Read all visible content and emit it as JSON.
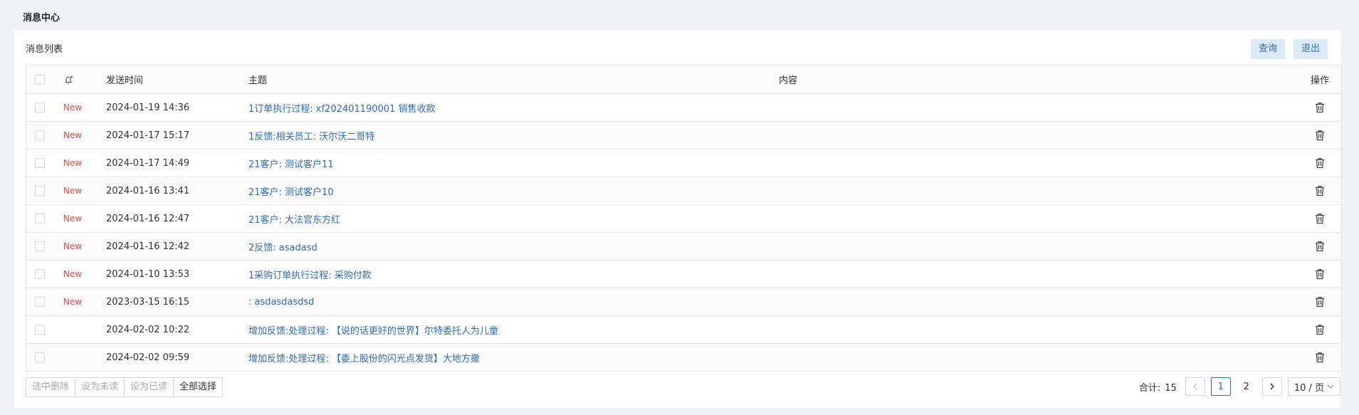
{
  "header": {
    "title": "消息中心"
  },
  "panel": {
    "title": "消息列表",
    "query_label": "查询",
    "exit_label": "退出"
  },
  "table": {
    "columns": {
      "time": "发送时间",
      "subject": "主题",
      "content": "内容",
      "operation": "操作"
    },
    "rows": [
      {
        "status": "New",
        "time": "2024-01-19 14:36",
        "subject": "1订单执行过程: xf202401190001 销售收款",
        "content": ""
      },
      {
        "status": "New",
        "time": "2024-01-17 15:17",
        "subject": "1反馈:相关员工: 沃尔沃二哥特",
        "content": ""
      },
      {
        "status": "New",
        "time": "2024-01-17 14:49",
        "subject": "21客户: 测试客户11",
        "content": ""
      },
      {
        "status": "New",
        "time": "2024-01-16 13:41",
        "subject": "21客户: 测试客户10",
        "content": ""
      },
      {
        "status": "New",
        "time": "2024-01-16 12:47",
        "subject": "21客户: 大法官东方红",
        "content": ""
      },
      {
        "status": "New",
        "time": "2024-01-16 12:42",
        "subject": "2反馈: asadasd",
        "content": ""
      },
      {
        "status": "New",
        "time": "2024-01-10 13:53",
        "subject": "1采购订单执行过程: 采购付款",
        "content": ""
      },
      {
        "status": "New",
        "time": "2023-03-15 16:15",
        "subject": ": asdasdasdsd",
        "content": ""
      },
      {
        "status": "",
        "time": "2024-02-02 10:22",
        "subject": "增加反馈:处理过程: 【说的话更好的世界】尔特委托人为儿童",
        "content": ""
      },
      {
        "status": "",
        "time": "2024-02-02 09:59",
        "subject": "增加反馈:处理过程: 【委上股份的闪光点发货】大地方撒",
        "content": ""
      }
    ]
  },
  "bulk": {
    "delete_selected": "选中删除",
    "mark_unread": "设为未读",
    "mark_read": "设为已读",
    "select_all": "全部选择"
  },
  "pagination": {
    "total_label": "合计:",
    "total": "15",
    "pages": [
      "1",
      "2"
    ],
    "current_page": "1",
    "page_size": "10 / 页"
  },
  "colors": {
    "accent": "#2f6db5",
    "new_badge": "#e24a4a",
    "button_bg": "#dce9f7"
  },
  "icons": {
    "bell": "bell-sync-icon",
    "delete": "trash-icon",
    "prev": "chevron-left-icon",
    "next": "chevron-right-icon",
    "dropdown": "chevron-down-icon"
  }
}
